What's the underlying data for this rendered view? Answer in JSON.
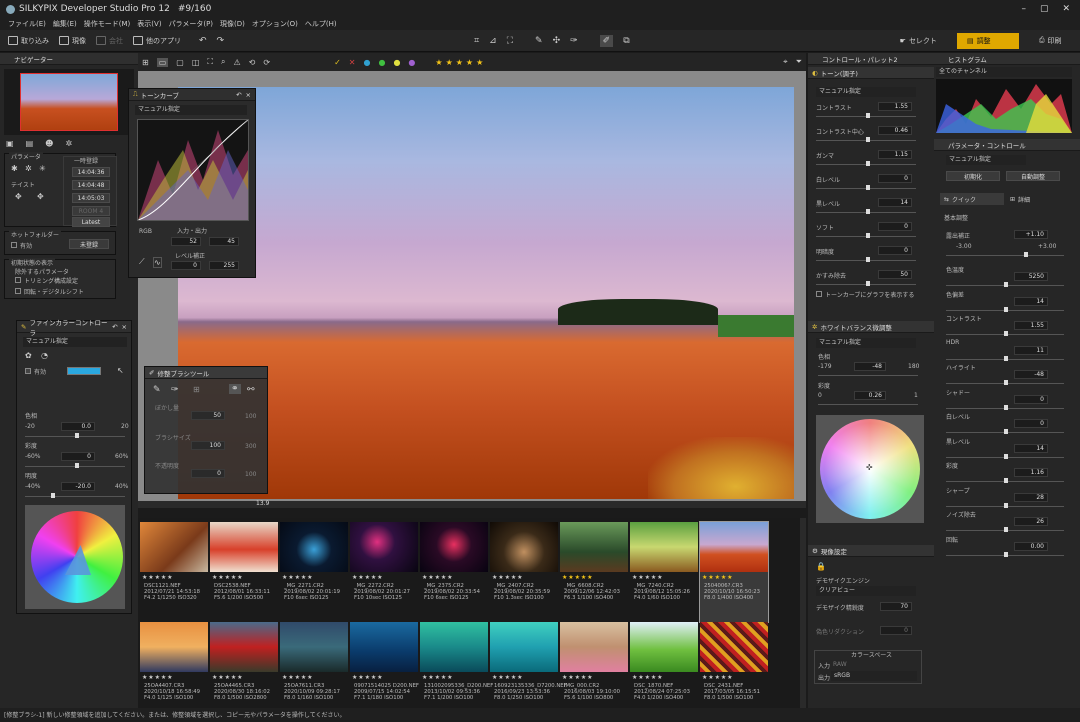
{
  "window": {
    "title": "SILKYPIX Developer Studio Pro 12",
    "counter": "#9/160"
  },
  "menu": [
    "ファイル(E)",
    "編集(E)",
    "操作モード(M)",
    "表示(V)",
    "パラメータ(P)",
    "現像(D)",
    "オプション(O)",
    "ヘルプ(H)"
  ],
  "toolbar": {
    "open": "取り込み",
    "develop": "現像",
    "print": "会社",
    "other_app": "他のアプリ",
    "select_mode": "セレクト",
    "adjust_mode": "調整",
    "print_mode": "印刷"
  },
  "rating_filter": "★★★★★",
  "navigator": {
    "title": "ナビゲーター"
  },
  "param_group": {
    "params_label": "パラメータ",
    "taste_label": "テイスト",
    "history_title": "一時登録",
    "times": [
      "14:04:36",
      "14:04:48",
      "14:05:03"
    ],
    "room4": "ROOM 4",
    "latest": "Latest"
  },
  "hotfolder": {
    "title": "ホットフォルダー",
    "enabled": "有効",
    "unregistered": "未登録"
  },
  "initial_view": {
    "title": "初期状態の表示",
    "exclude": "除外するパラメータ",
    "trim": "トリミング構成設定",
    "rotate": "回転・デジタルシフト"
  },
  "finecolor": {
    "title": "ファインカラーコントローラ",
    "preset": "マニュアル指定",
    "enabled": "有効",
    "hue_label": "色相",
    "hue_min": "-20",
    "hue_val": "0.0",
    "hue_max": "20",
    "sat_label": "彩度",
    "sat_min": "-60%",
    "sat_val": "0",
    "sat_max": "60%",
    "light_label": "明度",
    "light_min": "-40%",
    "light_val": "-20.0",
    "light_max": "40%"
  },
  "tonecurve": {
    "title": "トーンカーブ",
    "preset": "マニュアル指定",
    "channel": "RGB",
    "io_label": "入力・出力",
    "in_val": "52",
    "out_val": "45",
    "level_label": "レベル補正",
    "level_min": "0",
    "level_max": "255"
  },
  "repair": {
    "title": "修整ブラシツール",
    "density": "ぼかし量",
    "density_val": "50",
    "density_max": "100",
    "brush_size": "ブラシサイズ",
    "size_val": "100",
    "size_max": "300",
    "opacity": "不透明度",
    "opacity_val": "0",
    "opacity_max": "100"
  },
  "zoom": {
    "value": "13.9"
  },
  "control_palette": {
    "title": "コントロール・パレット2"
  },
  "tone": {
    "title": "トーン(調子)",
    "preset": "マニュアル指定",
    "rows": [
      {
        "label": "コントラスト",
        "value": "1.55"
      },
      {
        "label": "コントラスト中心",
        "value": "0.46"
      },
      {
        "label": "ガンマ",
        "value": "1.15"
      },
      {
        "label": "白レベル",
        "value": "0"
      },
      {
        "label": "黒レベル",
        "value": "14"
      },
      {
        "label": "ソフト",
        "value": "0"
      },
      {
        "label": "明暗度",
        "value": "0"
      },
      {
        "label": "かすみ除去",
        "value": "50"
      }
    ],
    "graph_toggle": "トーンカーブにグラフを表示する"
  },
  "wb": {
    "title": "ホワイトバランス微調整",
    "preset": "マニュアル指定",
    "hue_label": "色相",
    "hue_min": "-179",
    "hue_val": "-48",
    "hue_max": "180",
    "sat_label": "彩度",
    "sat_min": "0",
    "sat_val": "0.26",
    "sat_max": "1"
  },
  "engine": {
    "title": "現像設定",
    "engine_label": "デモザイクエンジン",
    "engine_val": "クリアビュー",
    "strength_label": "デモザイク精鋭度",
    "strength_val": "70",
    "noise_label": "偽色リダクション",
    "noise_val": "0",
    "colorspace_title": "カラースペース",
    "in_label": "入力",
    "in_val": "RAW",
    "out_label": "出力",
    "out_val": "sRGB"
  },
  "histogram": {
    "title": "ヒストグラム",
    "channel": "全てのチャンネル"
  },
  "param_ctrl": {
    "title": "パラメータ・コントロール",
    "preset": "マニュアル指定",
    "reset": "初期化",
    "auto": "自動調整",
    "quick": "クイック",
    "detail": "詳細",
    "basic": "基本調整",
    "exposure_label": "露出補正",
    "exposure_val": "+1.10",
    "exposure_min": "-3.00",
    "exposure_max": "+3.00",
    "rows": [
      {
        "label": "色温度",
        "value": "5250"
      },
      {
        "label": "色偏差",
        "value": "14"
      },
      {
        "label": "コントラスト",
        "value": "1.55"
      },
      {
        "label": "HDR",
        "value": "11"
      },
      {
        "label": "ハイライト",
        "value": "-48"
      },
      {
        "label": "シャドー",
        "value": "0"
      },
      {
        "label": "白レベル",
        "value": "0"
      },
      {
        "label": "黒レベル",
        "value": "14"
      },
      {
        "label": "彩度",
        "value": "1.16"
      },
      {
        "label": "シャープ",
        "value": "28"
      },
      {
        "label": "ノイズ除去",
        "value": "26"
      },
      {
        "label": "回転",
        "value": "0.00"
      }
    ]
  },
  "thumbs": [
    {
      "cap": "DSC1121.NEF\n2012/07/21 14:53:18\nF4.2 1/1250 ISO320",
      "stars": "★ ★ ★ ★ ★",
      "bg": "linear-gradient(135deg,#e0873a,#7a3a1a 60%,#c8b8a0)"
    },
    {
      "cap": "DSC2538.NEF\n2012/08/01 16:33:11\nF5.6 1/200 ISO500",
      "stars": "★ ★ ★ ★ ★",
      "bg": "linear-gradient(180deg,#e8d8c8,#d8402a 55%,#f0e0d0)"
    },
    {
      "cap": "_MG_2271.CR2\n2019/08/02 20:01:19\nF10 6sec ISO125",
      "stars": "★ ★ ★ ★ ★",
      "bg": "radial-gradient(circle at 50% 55%,#3aa0d8 0,#0a1a30 40%,#050a15)"
    },
    {
      "cap": "_MG_2272.CR2\n2019/08/02 20:01:27\nF10 10sec ISO125",
      "stars": "★ ★ ★ ★ ★",
      "bg": "radial-gradient(circle at 40% 40%,#e03080 0,#301040 35%,#080510)"
    },
    {
      "cap": "_MG_2375.CR2\n2019/08/02 20:33:54\nF10 6sec ISO125",
      "stars": "★ ★ ★ ★ ★",
      "bg": "radial-gradient(circle at 50% 45%,#e83060 0,#2a0a25 40%,#070310)"
    },
    {
      "cap": "_MG_2407.CR2\n2019/08/02 20:35:59\nF10 1.3sec ISO100",
      "stars": "★ ★ ★ ★ ★",
      "bg": "radial-gradient(circle at 50% 60%,#c09060 0,#3a2a18 45%,#100a05)"
    },
    {
      "cap": "_MG_6608.CR2\n2009/12/06 12:42:03\nF6.3 1/100 ISO400",
      "stars": "★ ★ ★ ★ ★",
      "bg": "linear-gradient(180deg,#6a9a5a,#2a4a2a 60%,#5a3a20)",
      "rated": true
    },
    {
      "cap": "_MG_7240.CR2\n2019/08/12 15:05:26\nF4.0 1/60 ISO100",
      "stars": "★ ★ ★ ★ ★",
      "bg": "linear-gradient(180deg,#5aa040,#c8d870 50%,#8a5a20)"
    },
    {
      "cap": "2504006?.CR3\n2020/10/10 16:50:23\nF8.0 1/400 ISO400",
      "stars": "★ ★ ★ ★ ★",
      "bg": "linear-gradient(180deg,#7aa0d8,#c8a8d0 45%,#d05020 65%,#b03010)",
      "rated": true,
      "selected": true
    },
    {
      "cap": "25OA4407.CR3\n2020/10/18 16:58:49\nF4.0 1/125 ISO100",
      "stars": "★ ★ ★ ★ ★",
      "bg": "linear-gradient(180deg,#e89040,#f0b060 50%,#303a60)"
    },
    {
      "cap": "25OA4465.CR3\n2020/08/30 18:16:02\nF8.0 1/500 ISO2800",
      "stars": "★ ★ ★ ★ ★",
      "bg": "linear-gradient(180deg,#4a6a8a,#c02020 50%,#3a3a2a)"
    },
    {
      "cap": "25OA7611.CR3\n2020/10/09 09:28:17\nF8.0 1/160 ISO100",
      "stars": "★ ★ ★ ★ ★",
      "bg": "linear-gradient(180deg,#304a6a,#3a6a7a 50%,#1a2a2a)"
    },
    {
      "cap": "09071514025 D200.NEF\n2009/07/15 14:02:54\nF7.1 1/180 ISO100",
      "stars": "★ ★ ★ ★ ★",
      "bg": "linear-gradient(180deg,#1a6aa0,#0a3a6a 60%,#082040)"
    },
    {
      "cap": "131002095336_D200.NEF\n2013/10/02 09:53:36\nF7.1 1/200 ISO100",
      "stars": "★ ★ ★ ★ ★",
      "bg": "linear-gradient(180deg,#30c0a0,#1a8a8a 50%,#0a4a5a)"
    },
    {
      "cap": "160923135336_D7200.NEF\n2016/09/23 13:53:36\nF8.0 1/250 ISO100",
      "stars": "★ ★ ★ ★ ★",
      "bg": "linear-gradient(180deg,#40d0c0,#20a0b0 50%,#0a6a7a)"
    },
    {
      "cap": "IMG_000.CR2\n2016/08/03 19:10:00\nF5.6 1/100 ISO800",
      "stars": "★ ★ ★ ★ ★",
      "bg": "linear-gradient(180deg,#d8c0a0,#c09070 50%,#e080a0)"
    },
    {
      "cap": "DSC_1870.NEF\n2012/08/24 07:25:03\nF4.0 1/200 ISO400",
      "stars": "★ ★ ★ ★ ★",
      "bg": "linear-gradient(180deg,#e0f0f8,#70c040 55%,#3a8a20)"
    },
    {
      "cap": "DSC_2431.NEF\n2017/03/05 16:15:51\nF8.0 1/500 ISO100",
      "stars": "★ ★ ★ ★ ★",
      "bg": "repeating-linear-gradient(45deg,#c02020 0 4px,#e0a020 4px 8px,#5a1a1a 8px 12px)"
    }
  ],
  "status": "[修整ブラシ-1] 新しい修整領域を追加してください。または、修整領域を選択し、コピー元やパラメータを操作してください。"
}
